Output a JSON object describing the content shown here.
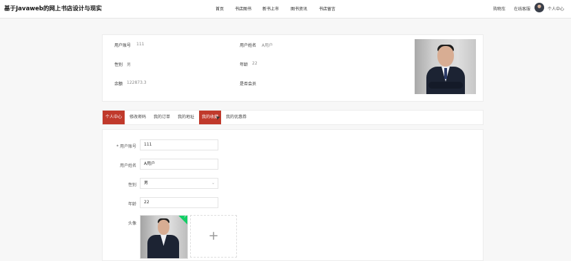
{
  "header": {
    "site_title": "基于Javaweb的网上书店设计与现实",
    "nav": [
      "首页",
      "书店图书",
      "新书上市",
      "图书资讯",
      "书店留言"
    ],
    "cart": "购物车",
    "online_service": "在线客服",
    "user_center": "个人中心"
  },
  "profile": {
    "account_label": "用户账号",
    "account_value": "111",
    "name_label": "用户姓名",
    "name_value": "A用户",
    "gender_label": "性别",
    "gender_value": "男",
    "age_label": "年龄",
    "age_value": "22",
    "balance_label": "余额",
    "balance_value": "122873.3",
    "vip_label": "是否会员"
  },
  "tabs": [
    "个人中心",
    "修改密码",
    "我的订单",
    "我的地址",
    "我的收藏",
    "我的优惠券"
  ],
  "active_tab_index": 0,
  "hover_tab_index": 4,
  "form": {
    "account": {
      "label": "* 用户账号",
      "value": "111"
    },
    "name": {
      "label": "用户姓名",
      "value": "A用户"
    },
    "gender": {
      "label": "性别",
      "value": "男"
    },
    "age": {
      "label": "年龄",
      "value": "22"
    },
    "avatar_label": "头像",
    "upload_plus": "+"
  },
  "colors": {
    "accent": "#c0392b",
    "success": "#13ce66"
  }
}
